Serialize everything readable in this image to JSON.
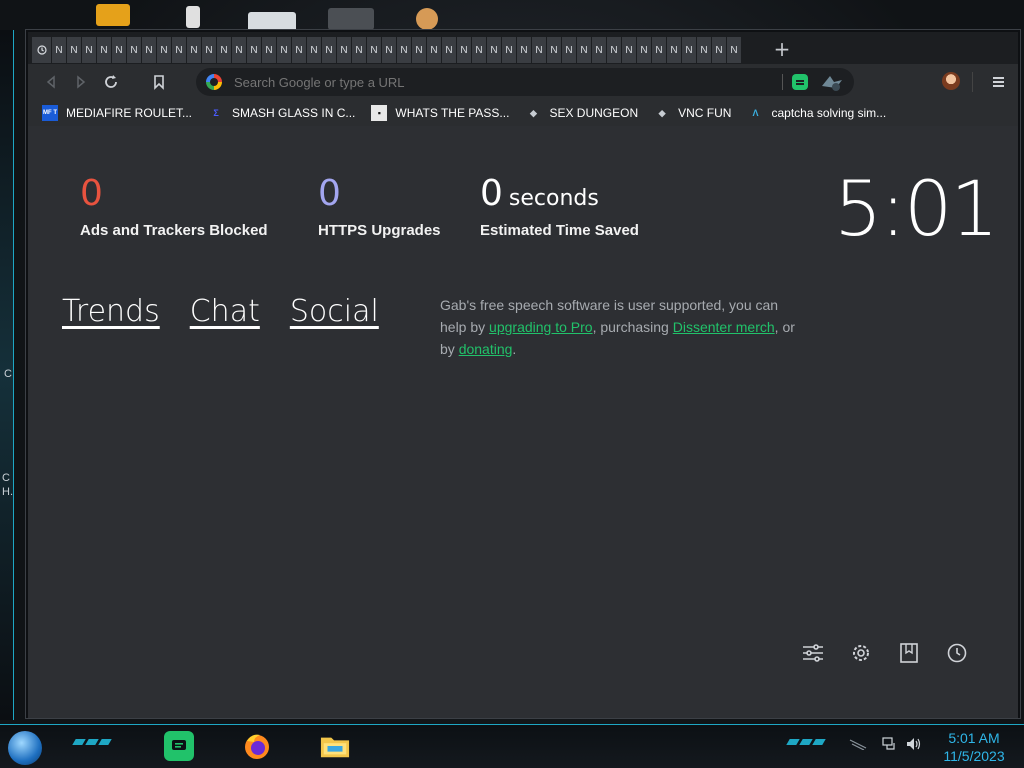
{
  "desktop": {
    "fragments": [
      "C",
      "C",
      "H."
    ]
  },
  "browser": {
    "tab_glyph": "N",
    "tab_count": 46,
    "new_tab_label": "+",
    "omnibox": {
      "placeholder": "Search Google or type a URL"
    },
    "bookmarks": [
      {
        "label": "MEDIAFIRE ROULET...",
        "icon": "mediafire-icon",
        "icon_text": "MF T",
        "color": "#1a5cd8"
      },
      {
        "label": "SMASH GLASS IN C...",
        "icon": "sigma-icon",
        "icon_text": "Σ",
        "color": "#4b5cff"
      },
      {
        "label": "WHATS THE PASS...",
        "icon": "terminal-icon",
        "icon_text": "▪",
        "color": "#111111"
      },
      {
        "label": "SEX DUNGEON",
        "icon": "chip-icon",
        "icon_text": "◆",
        "color": "#c7ccd2"
      },
      {
        "label": "VNC FUN",
        "icon": "chip-icon",
        "icon_text": "◆",
        "color": "#c7ccd2"
      },
      {
        "label": "captcha solving sim...",
        "icon": "lambda-icon",
        "icon_text": "Λ",
        "color": "#3ab0e0"
      }
    ]
  },
  "newtab": {
    "stats": [
      {
        "value": "0",
        "unit": "",
        "label": "Ads and Trackers Blocked",
        "color": "#e8533f"
      },
      {
        "value": "0",
        "unit": "",
        "label": "HTTPS Upgrades",
        "color": "#a3a6f0"
      },
      {
        "value": "0",
        "unit": "seconds",
        "label": "Estimated Time Saved",
        "color": "#ffffff"
      }
    ],
    "clock": "5:01",
    "nav_links": [
      "Trends",
      "Chat",
      "Social"
    ],
    "gab_message": {
      "part1": "Gab's free speech software is user supported, you can help by ",
      "link1": "upgrading to Pro",
      "part2": ", purchasing ",
      "link2": "Dissenter merch",
      "part3": ", or by ",
      "link3": "donating",
      "part4": "."
    }
  },
  "taskbar": {
    "time": "5:01 AM",
    "date": "11/5/2023"
  },
  "colors": {
    "accent_green": "#21c26a",
    "accent_cyan": "#1ea7c4",
    "clock_blue": "#2fb6e8"
  }
}
